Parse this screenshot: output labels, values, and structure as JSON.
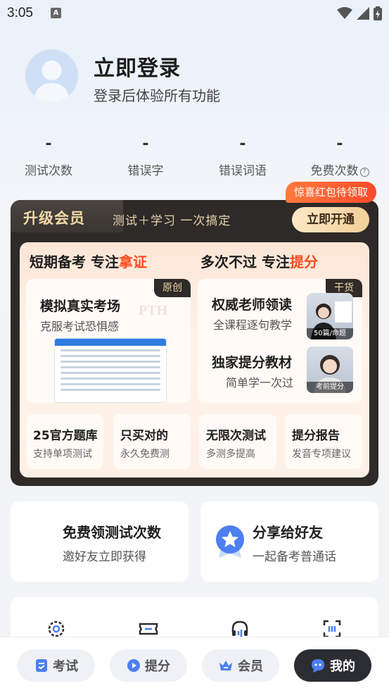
{
  "status_bar": {
    "time": "3:05",
    "a_icon_label": "A"
  },
  "profile": {
    "title": "立即登录",
    "subtitle": "登录后体验所有功能"
  },
  "stats": [
    {
      "value": "-",
      "label": "测试次数"
    },
    {
      "value": "-",
      "label": "错误字"
    },
    {
      "value": "-",
      "label": "错误词语"
    },
    {
      "value": "-",
      "label": "免费次数",
      "help": "?"
    }
  ],
  "vip": {
    "badge": "惊喜红包待领取",
    "title": "升级会员",
    "slogan": "测试＋学习 一次搞定",
    "open_button": "立即开通",
    "columns": [
      {
        "head": "短期备考 专注",
        "highlight": "拿证"
      },
      {
        "head": "多次不过 专注",
        "highlight": "提分"
      }
    ],
    "mock_exam": {
      "tag": "原创",
      "title": "模拟真实考场",
      "sub": "克服考试恐惧感",
      "watermark": "PTH"
    },
    "teachers": {
      "tag": "干货",
      "items": [
        {
          "title": "权威老师领读",
          "sub": "全课程逐句教学",
          "thumb_caption": "50篇/命题"
        },
        {
          "title": "独家提分教材",
          "sub": "简单学一次过",
          "thumb_caption": "考前提分"
        }
      ]
    },
    "minis": [
      {
        "title": "25官方题库",
        "sub": "支持单项测试"
      },
      {
        "title": "只买对的",
        "sub": "永久免费测"
      },
      {
        "title": "无限次测试",
        "sub": "多测多提高"
      },
      {
        "title": "提分报告",
        "sub": "发音专项建议"
      }
    ]
  },
  "actions": [
    {
      "title": "免费领测试次数",
      "sub": "邀好友立即获得"
    },
    {
      "title": "分享给好友",
      "sub": "一起备考普通话"
    }
  ],
  "tools": [
    "gear-icon",
    "ticket-icon",
    "headset-icon",
    "scan-icon"
  ],
  "nav": [
    {
      "label": "考试",
      "active": false
    },
    {
      "label": "提分",
      "active": false
    },
    {
      "label": "会员",
      "active": false
    },
    {
      "label": "我的",
      "active": true
    }
  ],
  "colors": {
    "accent_red": "#ff4b1f",
    "vip_dark": "#2d2a28",
    "vip_gold": "#f4d9a8",
    "nav_active": "#2c2d33"
  }
}
